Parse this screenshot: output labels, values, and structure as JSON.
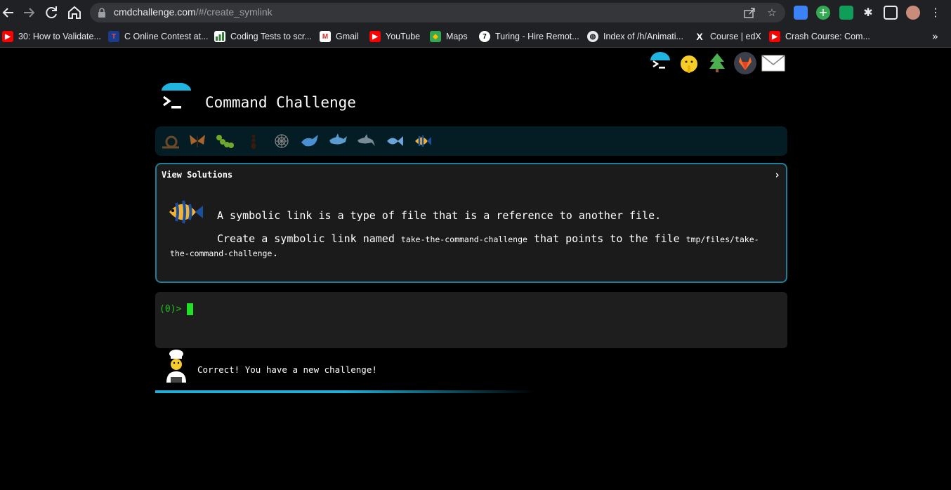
{
  "browser": {
    "url_host": "cmdchallenge.com",
    "url_path": "/#/create_symlink"
  },
  "bookmarks": [
    {
      "label": "30: How to Validate...",
      "icon": "youtube-icon"
    },
    {
      "label": "C Online Contest at...",
      "icon": "contest-icon"
    },
    {
      "label": "Coding Tests to scr...",
      "icon": "bar-chart-icon"
    },
    {
      "label": "Gmail",
      "icon": "gmail-icon"
    },
    {
      "label": "YouTube",
      "icon": "youtube-icon"
    },
    {
      "label": "Maps",
      "icon": "maps-icon"
    },
    {
      "label": "Turing - Hire Remot...",
      "icon": "turing-icon"
    },
    {
      "label": "Index of /h/Animati...",
      "icon": "globe-icon"
    },
    {
      "label": "Course | edX",
      "icon": "edx-icon"
    },
    {
      "label": "Crash Course: Com...",
      "icon": "youtube-icon"
    }
  ],
  "bookmarks_more": "»",
  "page": {
    "title": "Command Challenge",
    "view_solutions": "View Solutions",
    "chevron": "›",
    "description": "A symbolic link is a type of file that is a reference to another file.",
    "task_pre": "Create a symbolic link named ",
    "task_code1": "take-the-command-challenge",
    "task_mid": " that points to the file ",
    "task_code2": "tmp/files/take-the-command-challenge",
    "task_post": ".",
    "prompt": "(0)>",
    "status": "Correct! You have a new challenge!"
  },
  "colors": {
    "accent": "#1fb0d8",
    "border": "#1f7f9b",
    "prompt_green": "#21c321"
  }
}
